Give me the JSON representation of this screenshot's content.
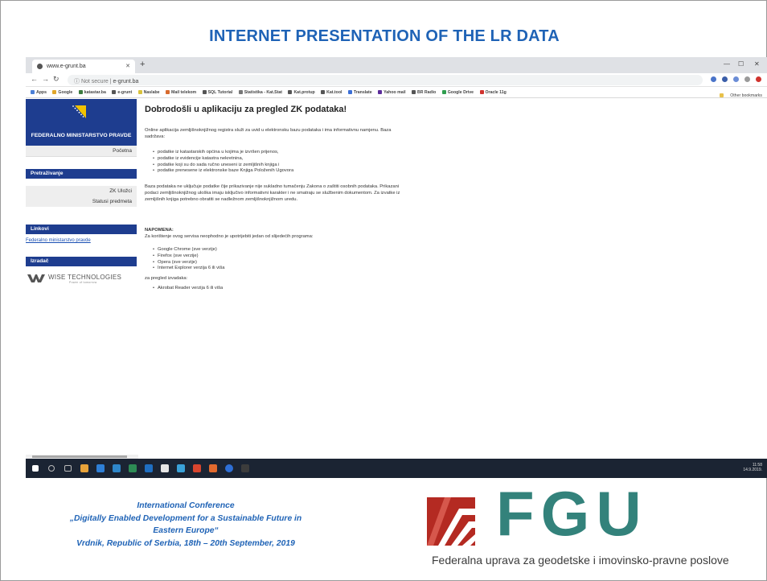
{
  "slide": {
    "heading": "INTERNET PRESENTATION OF THE LR DATA",
    "conference": {
      "line1": "International Conference",
      "line2": "„Digitally Enabled Development for a Sustainable Future in",
      "line3": "Eastern Europe“",
      "line4": "Vrdnik, Republic of Serbia, 18th – 20th September, 2019"
    },
    "logo": {
      "letters": "FGU",
      "tagline": "Federalna uprava za geodetske i imovinsko-pravne poslove"
    }
  },
  "browser": {
    "tab_title": "www.e-grunt.ba",
    "new_tab": "+",
    "not_secure": "Not secure",
    "url": "e-grunt.ba",
    "bookmarks": [
      "Apps",
      "Google",
      "katastar.ba",
      "e-grunt",
      "Naslabe",
      "Mail telekom",
      "SQL Tutorial",
      "Statistika - Kat.Stat",
      "Kat.protup",
      "Kat.tool",
      "Translate",
      "Yahoo mail",
      "BR Radio",
      "Google Drive",
      "Oracle 11g"
    ],
    "other_bookmarks": "Other bookmarks",
    "tray_time": "11:58",
    "tray_date": "14.9.2019."
  },
  "sidebar": {
    "ministry": "FEDERALNO MINISTARSTVO PRAVDE",
    "home": "Početna",
    "search_title": "Pretraživanje",
    "search_items": [
      "ZK Uložci",
      "Statusi predmeta"
    ],
    "links_title": "Linkovi",
    "link": "Federalno ministarstvo pravde",
    "maker_title": "Izradač",
    "maker": "WISE TECHNOLOGIES",
    "maker_sub": "Power of tomorrow"
  },
  "main": {
    "title": "Dobrodošli u aplikaciju za pregled ZK podataka!",
    "intro": "Online aplikacija zemljišnoknjižnog registra služi za uvid u elektronsku bazu podataka i ima informativnu namjenu. Baza sadržava:",
    "bullets": [
      "podatke iz katastarskih općina u kojima je izvršen prijenos,",
      "podatke iz evidencije katastra nekretnina,",
      "podatke koji su do sada ručno uneseni iz zemljišnih knjiga i",
      "podatke prenesene iz elektronske baze Knjiga Položenih Ugovora"
    ],
    "note": "Baza podataka ne uključuje podatke čije prikazivanje nije sukladno tumačenju Zakona o zaštiti osobnih podataka. Prikazani podaci zemljišnoknjižnog uloška imaju isključivo informativni karakter i ne smatraju se službenim dokumentom. Za izvatke iz zemljišnih knjiga potrebno obratiti se nadležnom zemljišnoknjižnom uredu.",
    "napomena": "NAPOMENA:",
    "napomena_text": "Za korištenje ovog servisa neophodno je upotrijebiti jedan od slijedećih programa:",
    "browsers": [
      "Google Chrome (sve verzije)",
      "Firefox (sve verzije)",
      "Opera (sve verzije)",
      "Internet Explorer verzija 6 ili viša"
    ],
    "viewer_text": "za pregled izvadaka:",
    "viewer": [
      "Akrobat Reader verzija 6 ili viša"
    ]
  }
}
